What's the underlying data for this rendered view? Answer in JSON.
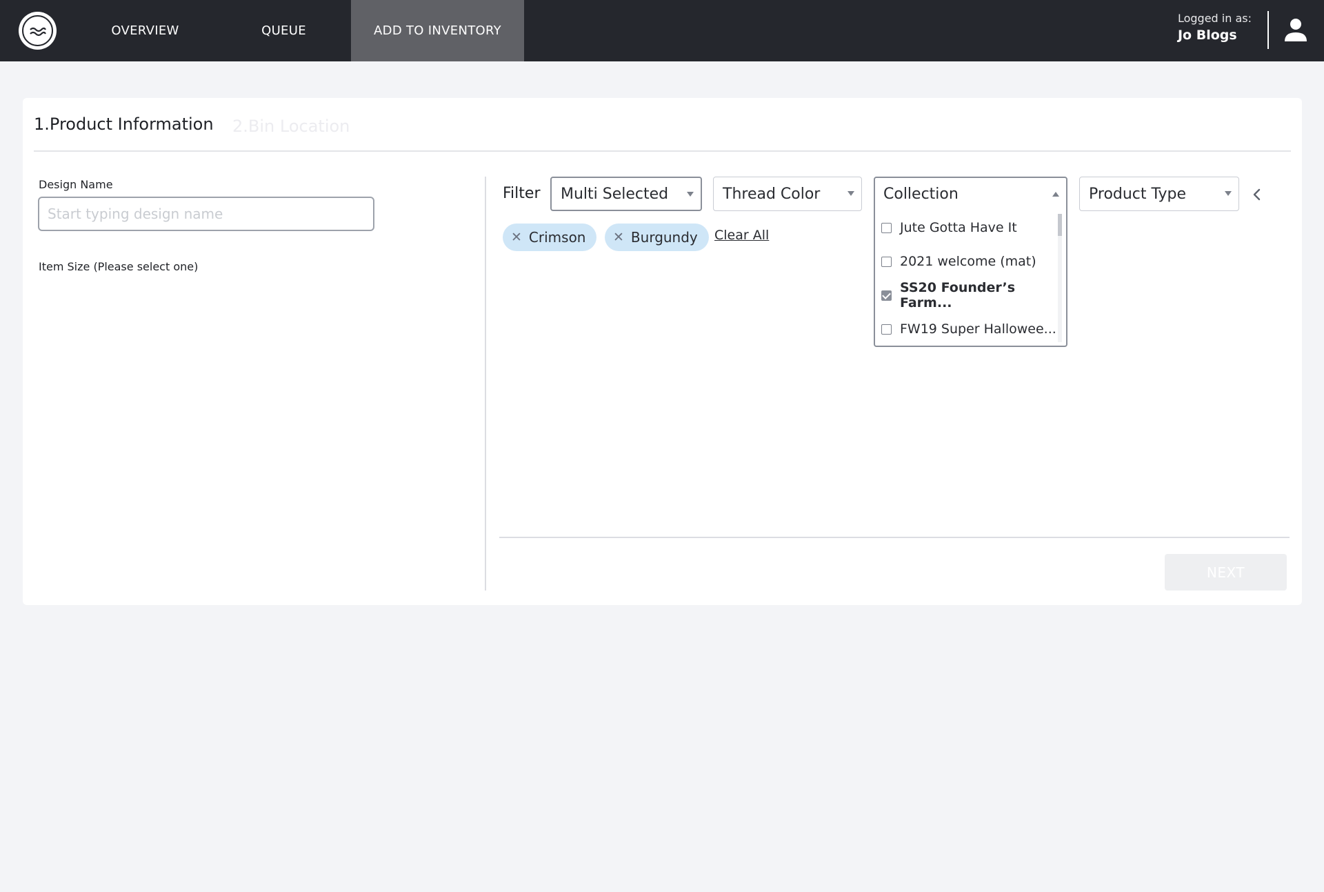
{
  "header": {
    "logo": "waves-logo-icon",
    "nav": [
      {
        "label": "OVERVIEW",
        "active": false
      },
      {
        "label": "QUEUE",
        "active": false
      },
      {
        "label": "ADD TO INVENTORY",
        "active": true
      }
    ],
    "user": {
      "label": "Logged in as:",
      "name": "Jo Blogs",
      "icon": "user-icon"
    }
  },
  "steps": {
    "active": "1.Product Information",
    "next": "2.Bin Location"
  },
  "form": {
    "design_name_label": "Design Name",
    "design_name_placeholder": "Start typing design name",
    "design_name_value": "",
    "item_size_label": "Item Size (Please select one)"
  },
  "filter": {
    "label": "Filter",
    "selects": {
      "primary": "Multi Selected",
      "thread_color": "Thread Color",
      "collection": "Collection",
      "product_type": "Product Type"
    },
    "chips": [
      "Crimson",
      "Burgundy"
    ],
    "clear_all": "Clear All",
    "collection_options": [
      {
        "label": "Jute Gotta Have It",
        "checked": false
      },
      {
        "label": "2021 welcome (mat)",
        "checked": false
      },
      {
        "label": "SS20 Founder’s Farm...",
        "checked": true
      },
      {
        "label": "FW19 Super Hallowee...",
        "checked": false
      }
    ]
  },
  "actions": {
    "next": "NEXT"
  },
  "colors": {
    "topbar": "#25272d",
    "active_nav": "#606166",
    "chip": "#cfe6f7",
    "page_bg": "#f3f4f7"
  }
}
